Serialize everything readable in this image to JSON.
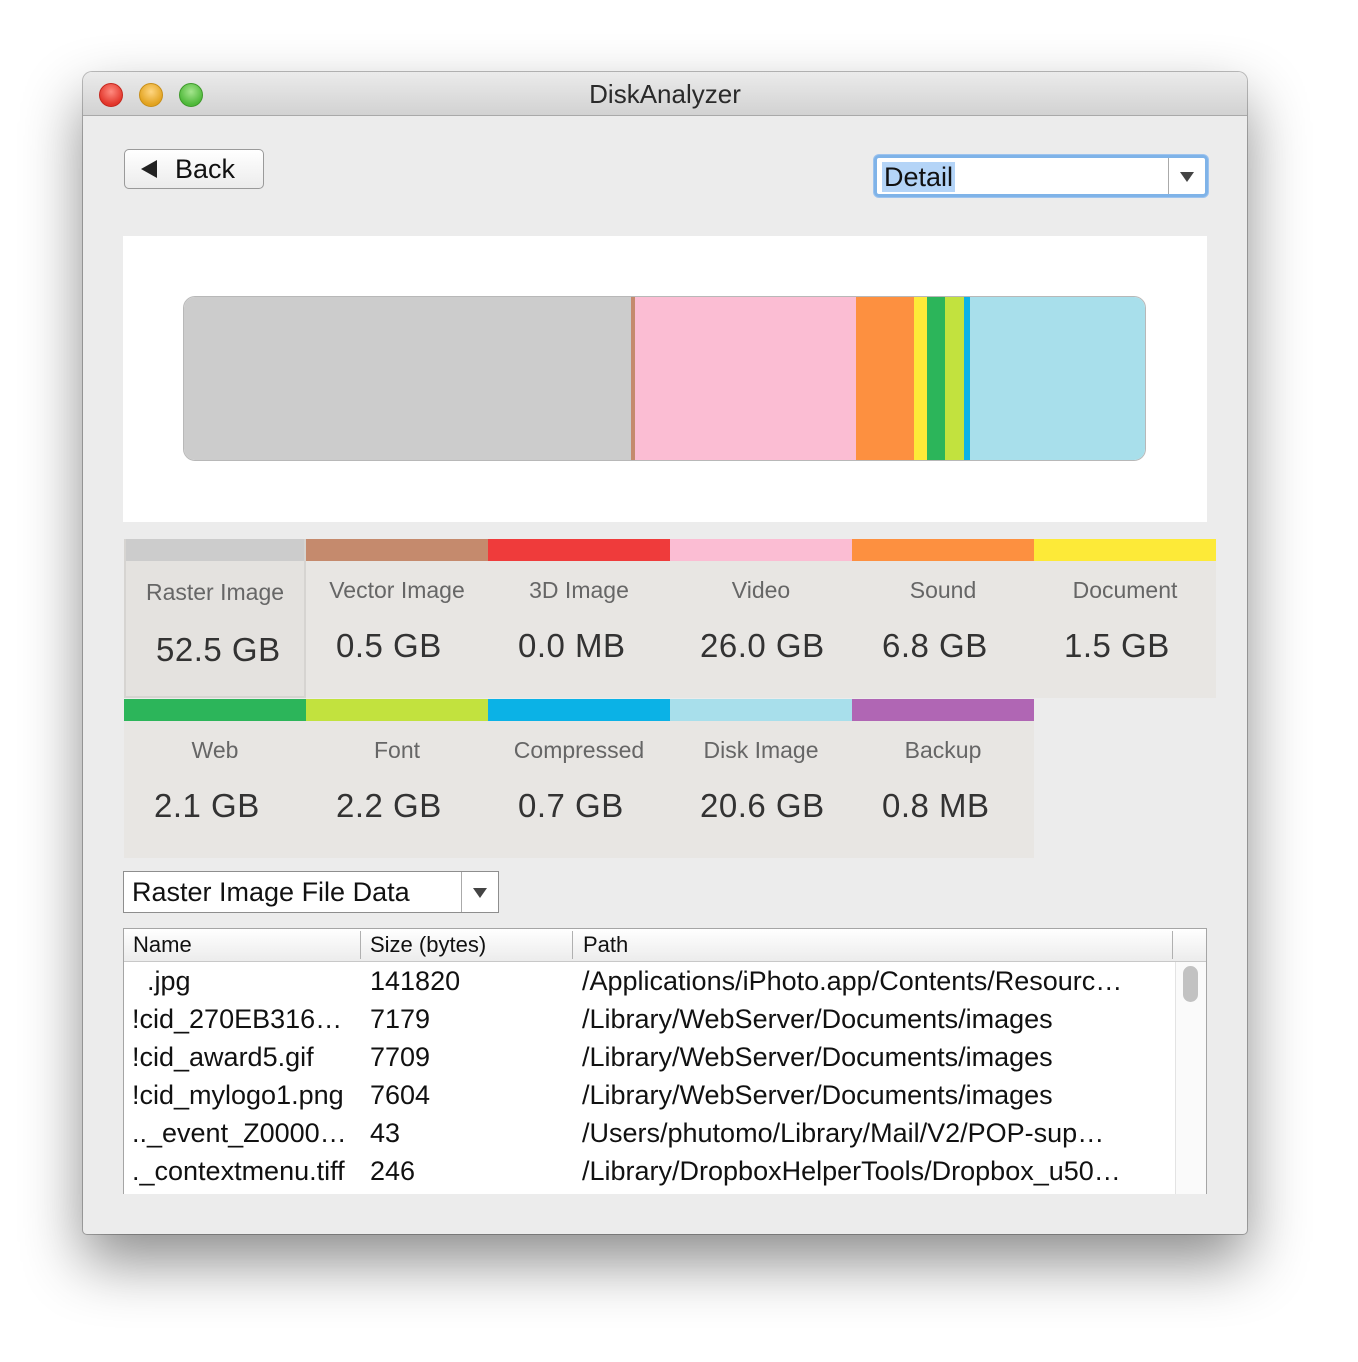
{
  "window": {
    "title": "DiskAnalyzer"
  },
  "toolbar": {
    "back_label": "Back",
    "view_select_value": "Detail"
  },
  "colors": {
    "raster": "#cccccc",
    "vector": "#c58a6d",
    "image3d": "#ef3b3b",
    "video": "#fbbdd3",
    "sound": "#fd9040",
    "document": "#fdea38",
    "web": "#2cb55a",
    "font": "#c2e23e",
    "compressed": "#0bb2e6",
    "disk_image": "#a8dfeb",
    "backup": "#b066b4"
  },
  "categories": [
    {
      "name": "Raster Image",
      "size": "52.5 GB"
    },
    {
      "name": "Vector Image",
      "size": "0.5 GB"
    },
    {
      "name": "3D Image",
      "size": "0.0 MB"
    },
    {
      "name": "Video",
      "size": "26.0 GB"
    },
    {
      "name": "Sound",
      "size": "6.8 GB"
    },
    {
      "name": "Document",
      "size": "1.5 GB"
    },
    {
      "name": "Web",
      "size": "2.1 GB"
    },
    {
      "name": "Font",
      "size": "2.2 GB"
    },
    {
      "name": "Compressed",
      "size": "0.7 GB"
    },
    {
      "name": "Disk Image",
      "size": "20.6 GB"
    },
    {
      "name": "Backup",
      "size": "0.8 MB"
    }
  ],
  "chart_data": {
    "type": "bar",
    "stacked": true,
    "unit": "GB",
    "categories": [
      "Raster Image",
      "Vector Image",
      "3D Image",
      "Video",
      "Sound",
      "Document",
      "Web",
      "Font",
      "Compressed",
      "Disk Image",
      "Backup"
    ],
    "values": [
      52.5,
      0.5,
      0.0,
      26.0,
      6.8,
      1.5,
      2.1,
      2.2,
      0.7,
      20.6,
      0.0008
    ],
    "colors": [
      "#cccccc",
      "#c58a6d",
      "#ef3b3b",
      "#fbbdd3",
      "#fd9040",
      "#fdea38",
      "#2cb55a",
      "#c2e23e",
      "#0bb2e6",
      "#a8dfeb",
      "#b066b4"
    ]
  },
  "file_data": {
    "select_value": "Raster Image File Data",
    "columns": [
      "Name",
      "Size (bytes)",
      "Path"
    ],
    "rows": [
      {
        "name": ".jpg",
        "size": "141820",
        "path": "/Applications/iPhoto.app/Contents/Resourc…"
      },
      {
        "name": "!cid_270EB316…",
        "size": "7179",
        "path": "/Library/WebServer/Documents/images"
      },
      {
        "name": "!cid_award5.gif",
        "size": "7709",
        "path": "/Library/WebServer/Documents/images"
      },
      {
        "name": "!cid_mylogo1.png",
        "size": "7604",
        "path": "/Library/WebServer/Documents/images"
      },
      {
        "name": ".._event_Z0000…",
        "size": "43",
        "path": "/Users/phutomo/Library/Mail/V2/POP-sup…"
      },
      {
        "name": "._contextmenu.tiff",
        "size": "246",
        "path": "/Library/DropboxHelperTools/Dropbox_u50…"
      }
    ]
  }
}
